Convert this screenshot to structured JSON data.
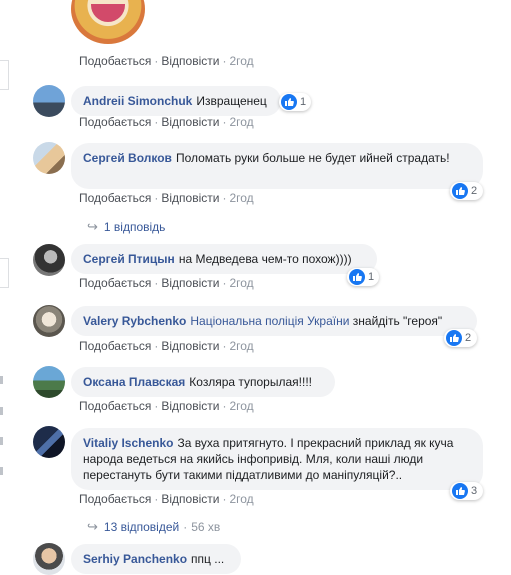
{
  "ui": {
    "like": "Подобається",
    "reply": "Відповісти",
    "dot": "·"
  },
  "comments": [
    {
      "time": "2год"
    },
    {
      "author": "Andreii Simonchuk",
      "text": "Извращенец",
      "time": "2год",
      "reactions": "1"
    },
    {
      "author": "Сергей Волков",
      "text": "Поломать руки больше не будет      ийней страдать!",
      "time": "2год",
      "reactions": "2",
      "replies": "1 відповідь"
    },
    {
      "author": "Сергей Птицын",
      "text": "на Медведева чем-то похож))))",
      "time": "2год",
      "reactions": "1"
    },
    {
      "author": "Valery Rybchenko",
      "tag": "Національна поліція України",
      "text": "знайдіть \"героя\"",
      "time": "2год",
      "reactions": "2"
    },
    {
      "author": "Оксана Плавская",
      "text": "Козляра тупорылая!!!!",
      "time": "2год"
    },
    {
      "author": "Vitaliy Ischenko",
      "text": "За вуха притягнуто. І прекрасний приклад як куча народа ведеться на якийсь інфопривід. Мля, коли наші люди перестануть бути такими піддатливими до маніпуляцій?..",
      "time": "2год",
      "reactions": "3",
      "replies": "13 відповідей",
      "replies_time": "56 хв"
    },
    {
      "author": "Serhiy Panchenko",
      "text": "ппц ..."
    }
  ],
  "colors": {
    "link": "#385898",
    "bubble": "#f2f3f5",
    "like": "#1877f2",
    "meta": "#8d949e"
  },
  "icons": {
    "like": "thumbs-up-icon",
    "reply_arrow": "reply-arrow-icon"
  }
}
